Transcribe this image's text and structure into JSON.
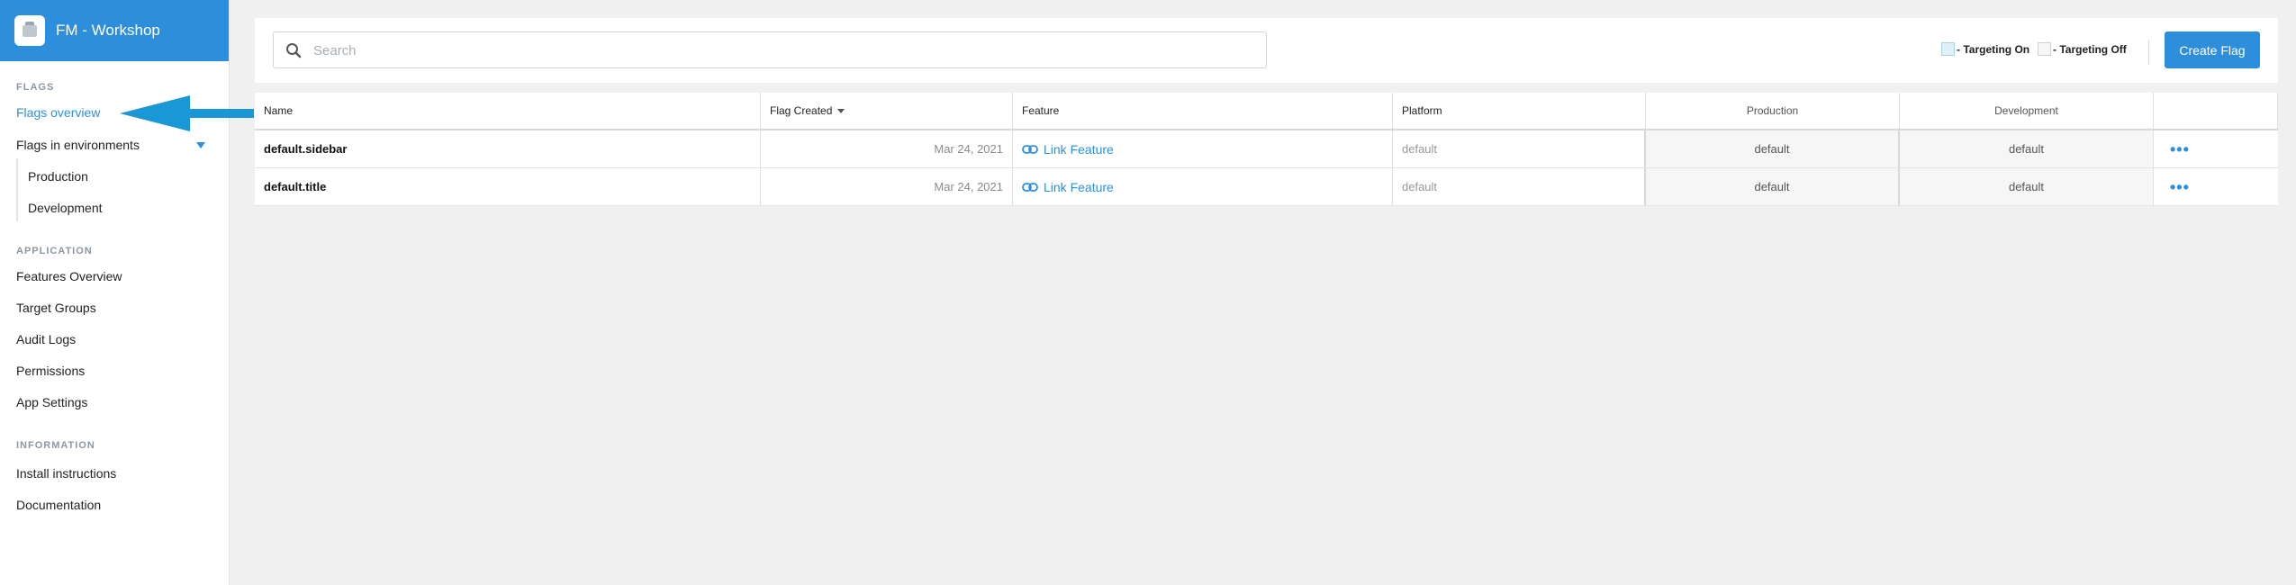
{
  "app": {
    "title": "FM - Workshop"
  },
  "sidebar": {
    "flags_label": "FLAGS",
    "flags_overview": "Flags overview",
    "flags_in_environments": "Flags in environments",
    "environments": [
      "Production",
      "Development"
    ],
    "application_label": "APPLICATION",
    "application_items": [
      "Features Overview",
      "Target Groups",
      "Audit Logs",
      "Permissions",
      "App Settings"
    ],
    "information_label": "INFORMATION",
    "information_items": [
      "Install instructions",
      "Documentation"
    ]
  },
  "toolbar": {
    "search_placeholder": "Search",
    "search_value": "",
    "legend_on": "- Targeting On",
    "legend_off": "- Targeting Off",
    "create_label": "Create Flag"
  },
  "table": {
    "headers": {
      "name": "Name",
      "created": "Flag Created",
      "feature": "Feature",
      "platform": "Platform",
      "production": "Production",
      "development": "Development"
    },
    "rows": [
      {
        "name": "default.sidebar",
        "created": "Mar 24, 2021",
        "feature": "Link Feature",
        "platform": "default",
        "production": "default",
        "development": "default",
        "actions": "•••"
      },
      {
        "name": "default.title",
        "created": "Mar 24, 2021",
        "feature": "Link Feature",
        "platform": "default",
        "production": "default",
        "development": "default",
        "actions": "•••"
      }
    ]
  },
  "colors": {
    "accent": "#2d8fdb",
    "arrow": "#1a98d6",
    "targeting_on": "#dff1f7"
  }
}
